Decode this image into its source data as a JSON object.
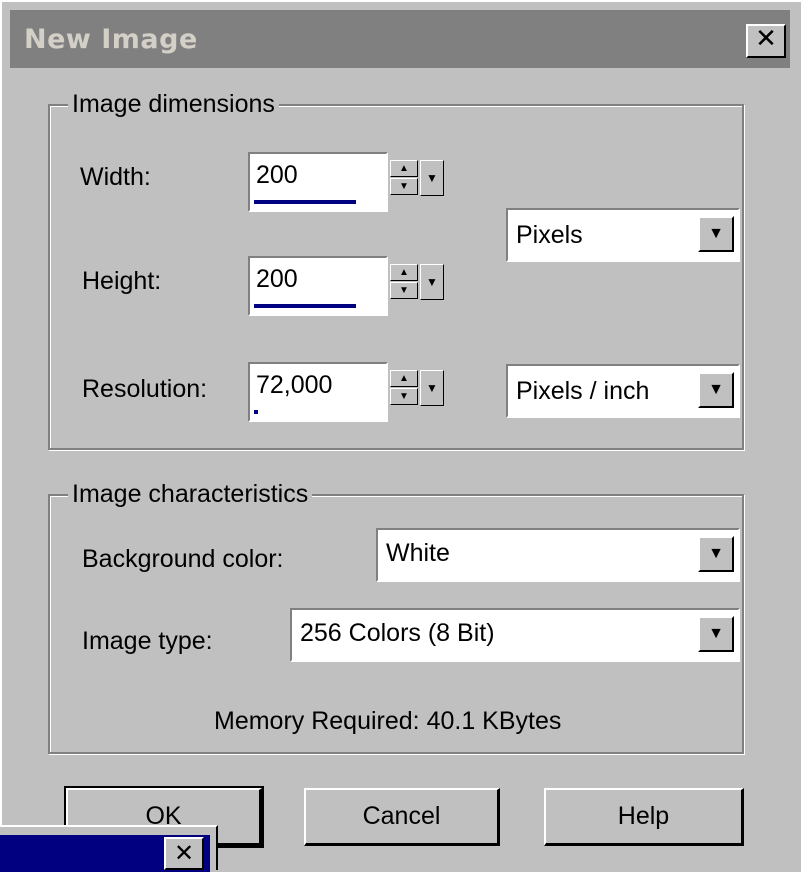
{
  "window": {
    "title": "New Image",
    "close_label": "✕"
  },
  "dimensions": {
    "group_title": "Image dimensions",
    "width_label": "Width:",
    "width_value": "200",
    "height_label": "Height:",
    "height_value": "200",
    "resolution_label": "Resolution:",
    "resolution_value": "72,000",
    "size_unit": "Pixels",
    "resolution_unit": "Pixels / inch"
  },
  "characteristics": {
    "group_title": "Image characteristics",
    "background_label": "Background color:",
    "background_value": "White",
    "type_label": "Image type:",
    "type_value": "256 Colors (8 Bit)",
    "memory_text": "Memory Required: 40.1 KBytes"
  },
  "buttons": {
    "ok": "OK",
    "cancel": "Cancel",
    "help": "Help"
  },
  "sub_window": {
    "close_label": "✕"
  },
  "colors": {
    "dialog_bg": "#c0c0c0",
    "title_bar_inactive": "#808080",
    "accent_navy": "#000080"
  }
}
